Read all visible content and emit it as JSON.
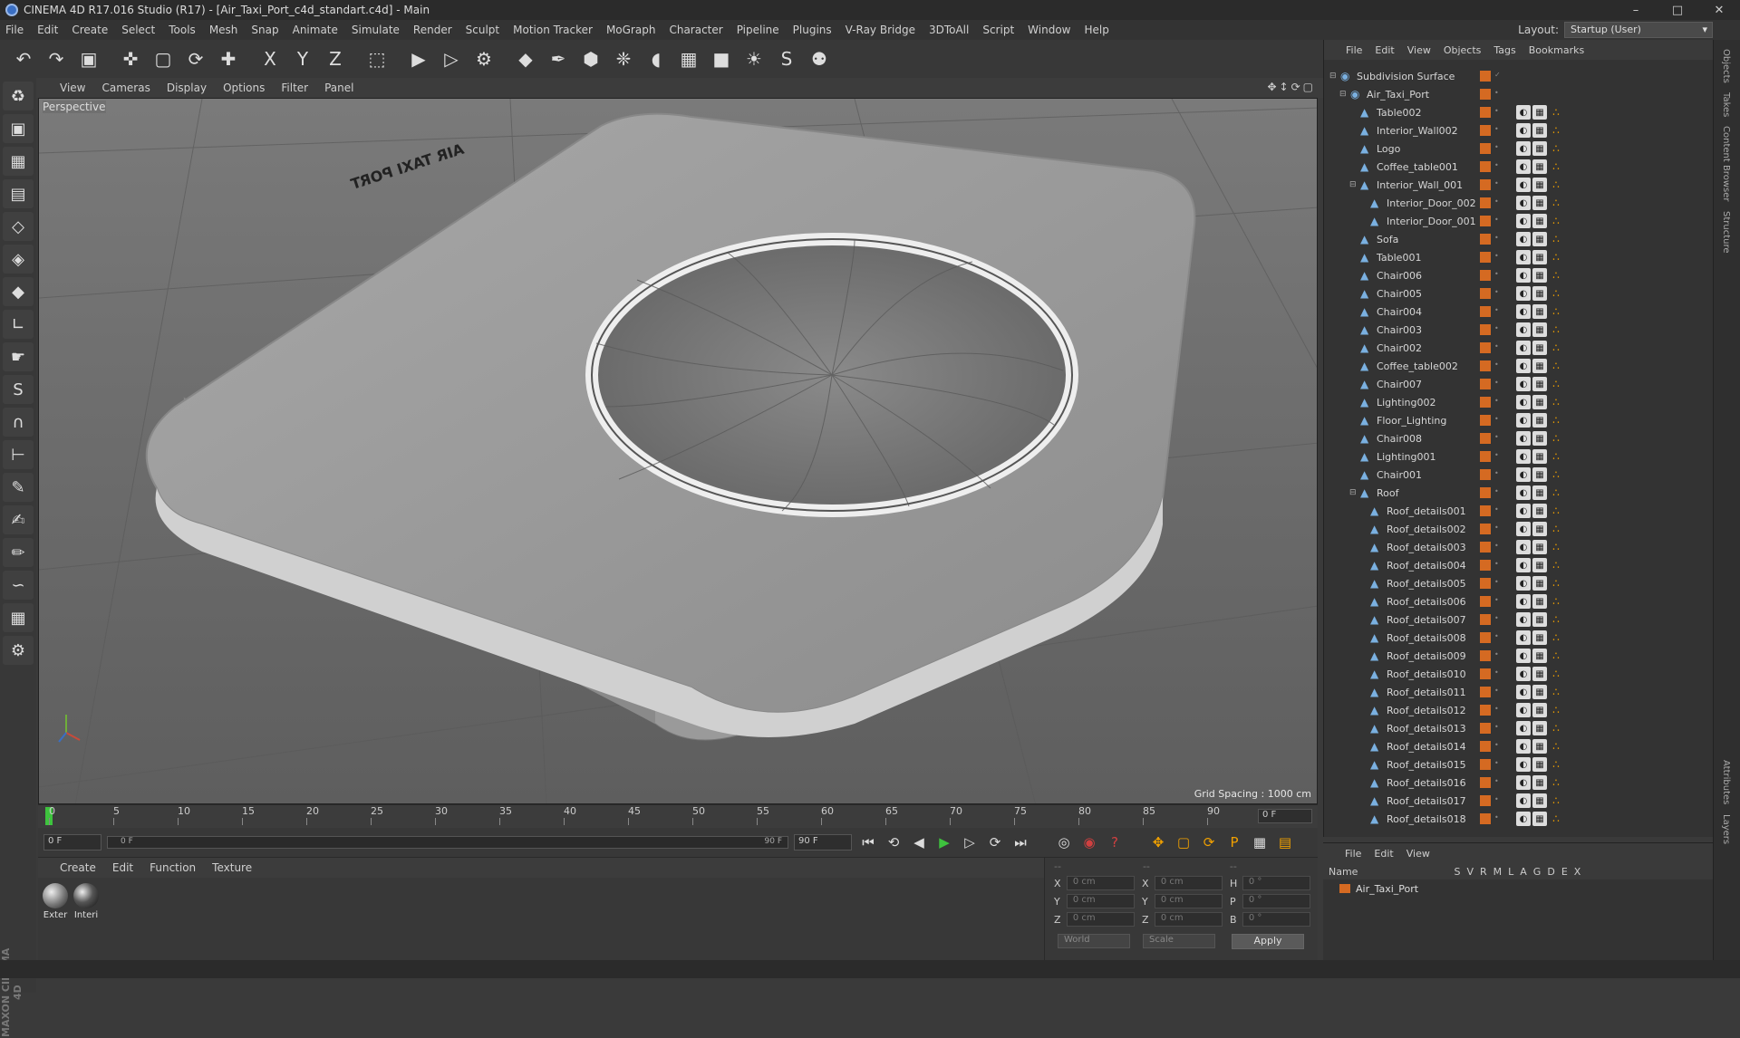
{
  "window": {
    "title": "CINEMA 4D R17.016 Studio (R17) - [Air_Taxi_Port_c4d_standart.c4d] - Main",
    "controls": [
      "–",
      "□",
      "✕"
    ]
  },
  "menu": [
    "File",
    "Edit",
    "Create",
    "Select",
    "Tools",
    "Mesh",
    "Snap",
    "Animate",
    "Simulate",
    "Render",
    "Sculpt",
    "Motion Tracker",
    "MoGraph",
    "Character",
    "Pipeline",
    "Plugins",
    "V-Ray Bridge",
    "3DToAll",
    "Script",
    "Window",
    "Help"
  ],
  "layout": {
    "label": "Layout:",
    "value": "Startup (User)"
  },
  "toolbar": [
    "undo-icon",
    "redo-icon",
    "select-icon",
    "move-icon",
    "scale-icon",
    "rotate-icon",
    "live-select-icon",
    "x-axis-icon",
    "y-axis-icon",
    "z-axis-icon",
    "coord-system-icon",
    "render-view-icon",
    "render-picture-viewer-icon",
    "render-settings-icon",
    "cube-icon",
    "pen-icon",
    "subdivision-icon",
    "cloner-icon",
    "deformer-icon",
    "floor-icon",
    "camera-icon",
    "light-icon",
    "sketch-icon",
    "python-icon"
  ],
  "toolbar_glyphs": [
    "↶",
    "↷",
    "▣",
    "✜",
    "▢",
    "⟳",
    "✚",
    "X",
    "Y",
    "Z",
    "⬚",
    "▶",
    "▷",
    "⚙",
    "◆",
    "✒",
    "⬢",
    "❈",
    "◖",
    "▦",
    "■",
    "☀",
    "S",
    "⚉"
  ],
  "viewport": {
    "menu": [
      "View",
      "Cameras",
      "Display",
      "Options",
      "Filter",
      "Panel"
    ],
    "label": "Perspective",
    "grid_spacing": "Grid Spacing : 1000 cm",
    "logo_text": "AIR TAXI PORT"
  },
  "timeline": {
    "ticks": [
      "0",
      "5",
      "10",
      "15",
      "20",
      "25",
      "30",
      "35",
      "40",
      "45",
      "50",
      "55",
      "60",
      "65",
      "70",
      "75",
      "80",
      "85",
      "90"
    ],
    "current": "0 F"
  },
  "transport": {
    "start": "0 F",
    "slider_left": "0 F",
    "slider_right": "90 F",
    "end": "90 F"
  },
  "materials": {
    "menu": [
      "Create",
      "Edit",
      "Function",
      "Texture"
    ],
    "items": [
      "Exter",
      "Interi"
    ]
  },
  "coords": {
    "rows": [
      {
        "a1": "X",
        "v1": "0 cm",
        "a2": "X",
        "v2": "0 cm",
        "a3": "H",
        "v3": "0 °"
      },
      {
        "a1": "Y",
        "v1": "0 cm",
        "a2": "Y",
        "v2": "0 cm",
        "a3": "P",
        "v3": "0 °"
      },
      {
        "a1": "Z",
        "v1": "0 cm",
        "a2": "Z",
        "v2": "0 cm",
        "a3": "B",
        "v3": "0 °"
      }
    ],
    "mode1": "World",
    "mode2": "Scale",
    "apply": "Apply"
  },
  "objects": {
    "menu": [
      "File",
      "Edit",
      "View",
      "Objects",
      "Tags",
      "Bookmarks"
    ],
    "items": [
      {
        "name": "Subdivision Surface",
        "level": 0,
        "exp": "⊟",
        "icon": "subdivision-icon"
      },
      {
        "name": "Air_Taxi_Port",
        "level": 1,
        "exp": "⊟",
        "icon": "null-icon"
      },
      {
        "name": "Table002",
        "level": 2,
        "exp": "",
        "icon": "polygon-icon"
      },
      {
        "name": "Interior_Wall002",
        "level": 2,
        "exp": "",
        "icon": "polygon-icon"
      },
      {
        "name": "Logo",
        "level": 2,
        "exp": "",
        "icon": "polygon-icon"
      },
      {
        "name": "Coffee_table001",
        "level": 2,
        "exp": "",
        "icon": "polygon-icon"
      },
      {
        "name": "Interior_Wall_001",
        "level": 2,
        "exp": "⊟",
        "icon": "polygon-icon"
      },
      {
        "name": "Interior_Door_002",
        "level": 3,
        "exp": "",
        "icon": "polygon-icon"
      },
      {
        "name": "Interior_Door_001",
        "level": 3,
        "exp": "",
        "icon": "polygon-icon"
      },
      {
        "name": "Sofa",
        "level": 2,
        "exp": "",
        "icon": "polygon-icon"
      },
      {
        "name": "Table001",
        "level": 2,
        "exp": "",
        "icon": "polygon-icon"
      },
      {
        "name": "Chair006",
        "level": 2,
        "exp": "",
        "icon": "polygon-icon"
      },
      {
        "name": "Chair005",
        "level": 2,
        "exp": "",
        "icon": "polygon-icon"
      },
      {
        "name": "Chair004",
        "level": 2,
        "exp": "",
        "icon": "polygon-icon"
      },
      {
        "name": "Chair003",
        "level": 2,
        "exp": "",
        "icon": "polygon-icon"
      },
      {
        "name": "Chair002",
        "level": 2,
        "exp": "",
        "icon": "polygon-icon"
      },
      {
        "name": "Coffee_table002",
        "level": 2,
        "exp": "",
        "icon": "polygon-icon"
      },
      {
        "name": "Chair007",
        "level": 2,
        "exp": "",
        "icon": "polygon-icon"
      },
      {
        "name": "Lighting002",
        "level": 2,
        "exp": "",
        "icon": "polygon-icon"
      },
      {
        "name": "Floor_Lighting",
        "level": 2,
        "exp": "",
        "icon": "polygon-icon"
      },
      {
        "name": "Chair008",
        "level": 2,
        "exp": "",
        "icon": "polygon-icon"
      },
      {
        "name": "Lighting001",
        "level": 2,
        "exp": "",
        "icon": "polygon-icon"
      },
      {
        "name": "Chair001",
        "level": 2,
        "exp": "",
        "icon": "polygon-icon"
      },
      {
        "name": "Roof",
        "level": 2,
        "exp": "⊟",
        "icon": "polygon-icon"
      },
      {
        "name": "Roof_details001",
        "level": 3,
        "exp": "",
        "icon": "polygon-icon"
      },
      {
        "name": "Roof_details002",
        "level": 3,
        "exp": "",
        "icon": "polygon-icon"
      },
      {
        "name": "Roof_details003",
        "level": 3,
        "exp": "",
        "icon": "polygon-icon"
      },
      {
        "name": "Roof_details004",
        "level": 3,
        "exp": "",
        "icon": "polygon-icon"
      },
      {
        "name": "Roof_details005",
        "level": 3,
        "exp": "",
        "icon": "polygon-icon"
      },
      {
        "name": "Roof_details006",
        "level": 3,
        "exp": "",
        "icon": "polygon-icon"
      },
      {
        "name": "Roof_details007",
        "level": 3,
        "exp": "",
        "icon": "polygon-icon"
      },
      {
        "name": "Roof_details008",
        "level": 3,
        "exp": "",
        "icon": "polygon-icon"
      },
      {
        "name": "Roof_details009",
        "level": 3,
        "exp": "",
        "icon": "polygon-icon"
      },
      {
        "name": "Roof_details010",
        "level": 3,
        "exp": "",
        "icon": "polygon-icon"
      },
      {
        "name": "Roof_details011",
        "level": 3,
        "exp": "",
        "icon": "polygon-icon"
      },
      {
        "name": "Roof_details012",
        "level": 3,
        "exp": "",
        "icon": "polygon-icon"
      },
      {
        "name": "Roof_details013",
        "level": 3,
        "exp": "",
        "icon": "polygon-icon"
      },
      {
        "name": "Roof_details014",
        "level": 3,
        "exp": "",
        "icon": "polygon-icon"
      },
      {
        "name": "Roof_details015",
        "level": 3,
        "exp": "",
        "icon": "polygon-icon"
      },
      {
        "name": "Roof_details016",
        "level": 3,
        "exp": "",
        "icon": "polygon-icon"
      },
      {
        "name": "Roof_details017",
        "level": 3,
        "exp": "",
        "icon": "polygon-icon"
      },
      {
        "name": "Roof_details018",
        "level": 3,
        "exp": "",
        "icon": "polygon-icon"
      }
    ]
  },
  "side_tabs": [
    "Objects",
    "Takes",
    "Content Browser",
    "Structure"
  ],
  "layers": {
    "menu": [
      "File",
      "Edit",
      "View"
    ],
    "header": [
      "Name",
      "S",
      "V",
      "R",
      "M",
      "L",
      "A",
      "G",
      "D",
      "E",
      "X"
    ],
    "items": [
      "Air_Taxi_Port"
    ],
    "side_tabs": [
      "Attributes",
      "Layers"
    ]
  },
  "colors": {
    "layer": "#d56a22",
    "accent": "#3ec33e"
  }
}
